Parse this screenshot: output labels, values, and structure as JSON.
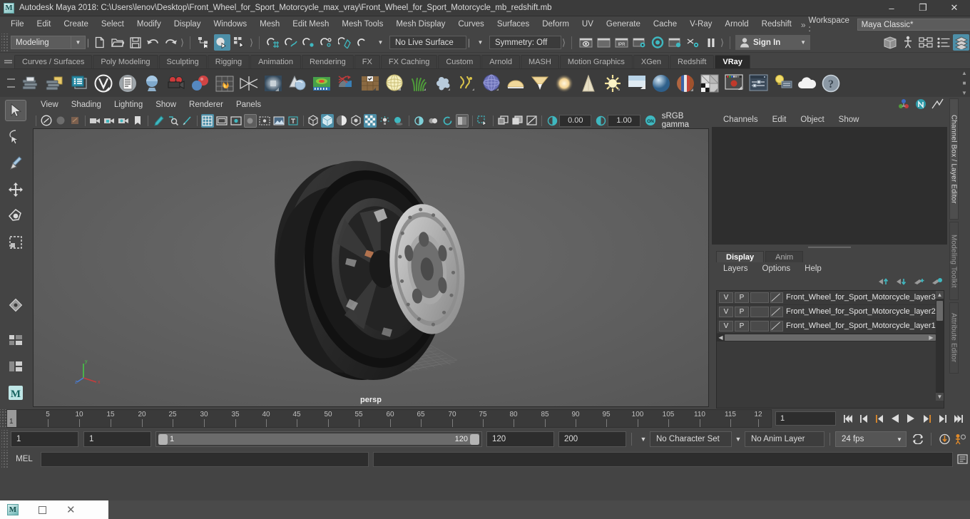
{
  "titlebar": {
    "title": "Autodesk Maya 2018: C:\\Users\\lenov\\Desktop\\Front_Wheel_for_Sport_Motorcycle_max_vray\\Front_Wheel_for_Sport_Motorcycle_mb_redshift.mb",
    "logo": "M",
    "minimize": "–",
    "maximize": "❐",
    "close": "✕"
  },
  "menubar": {
    "items": [
      "File",
      "Edit",
      "Create",
      "Select",
      "Modify",
      "Display",
      "Windows",
      "Mesh",
      "Edit Mesh",
      "Mesh Tools",
      "Mesh Display",
      "Curves",
      "Surfaces",
      "Deform",
      "UV",
      "Generate",
      "Cache",
      "V-Ray",
      "Arnold",
      "Redshift"
    ],
    "overflow": "»",
    "workspace_label": "Workspace :",
    "workspace_value": "Maya Classic*"
  },
  "statusline": {
    "mode": "Modeling",
    "live_surface": "No Live Surface",
    "symmetry": "Symmetry: Off",
    "signin": "Sign In"
  },
  "shelf": {
    "tabs": [
      "Curves / Surfaces",
      "Poly Modeling",
      "Sculpting",
      "Rigging",
      "Animation",
      "Rendering",
      "FX",
      "FX Caching",
      "Custom",
      "Arnold",
      "MASH",
      "Motion Graphics",
      "XGen",
      "Redshift",
      "VRay"
    ],
    "active_tab": "VRay"
  },
  "viewport": {
    "menus": [
      "View",
      "Shading",
      "Lighting",
      "Show",
      "Renderer",
      "Panels"
    ],
    "exposure": "0.00",
    "gamma": "1.00",
    "color_space": "sRGB gamma",
    "camera_label": "persp",
    "axis_x": "x",
    "axis_y": "y",
    "axis_z": "z"
  },
  "channelbox": {
    "menus": [
      "Channels",
      "Edit",
      "Object",
      "Show"
    ],
    "side_tabs": [
      "Channel Box / Layer Editor",
      "Modeling Toolkit",
      "Attribute Editor"
    ]
  },
  "layers": {
    "tabs": [
      "Display",
      "Anim"
    ],
    "active_tab": "Display",
    "menus": [
      "Layers",
      "Options",
      "Help"
    ],
    "col_v": "V",
    "col_p": "P",
    "rows": [
      {
        "v": "V",
        "p": "P",
        "name": "Front_Wheel_for_Sport_Motorcycle_layer3"
      },
      {
        "v": "V",
        "p": "P",
        "name": "Front_Wheel_for_Sport_Motorcycle_layer2"
      },
      {
        "v": "V",
        "p": "P",
        "name": "Front_Wheel_for_Sport_Motorcycle_layer1"
      }
    ]
  },
  "timeline": {
    "ticks": [
      "5",
      "10",
      "15",
      "20",
      "25",
      "30",
      "35",
      "40",
      "45",
      "50",
      "55",
      "60",
      "65",
      "70",
      "75",
      "80",
      "85",
      "90",
      "95",
      "100",
      "105",
      "110",
      "115",
      "12"
    ],
    "current_frame_marker": "1",
    "current_frame_field": "1"
  },
  "range": {
    "start": "1",
    "anim_start": "1",
    "slider_min": "1",
    "slider_max": "120",
    "anim_end": "120",
    "end": "200",
    "character_set": "No Character Set",
    "anim_layer": "No Anim Layer",
    "fps": "24 fps"
  },
  "command": {
    "label": "MEL",
    "input_value": "",
    "output_value": ""
  },
  "taskbar": {
    "app": "M",
    "restore": "□",
    "close": "✕"
  },
  "colors": {
    "accent": "#4d8fa8",
    "window_bg": "#444444",
    "panel_dark": "#2e2e2e",
    "viewport_bg": "#5d5d5d",
    "orange": "#e08a2a"
  }
}
